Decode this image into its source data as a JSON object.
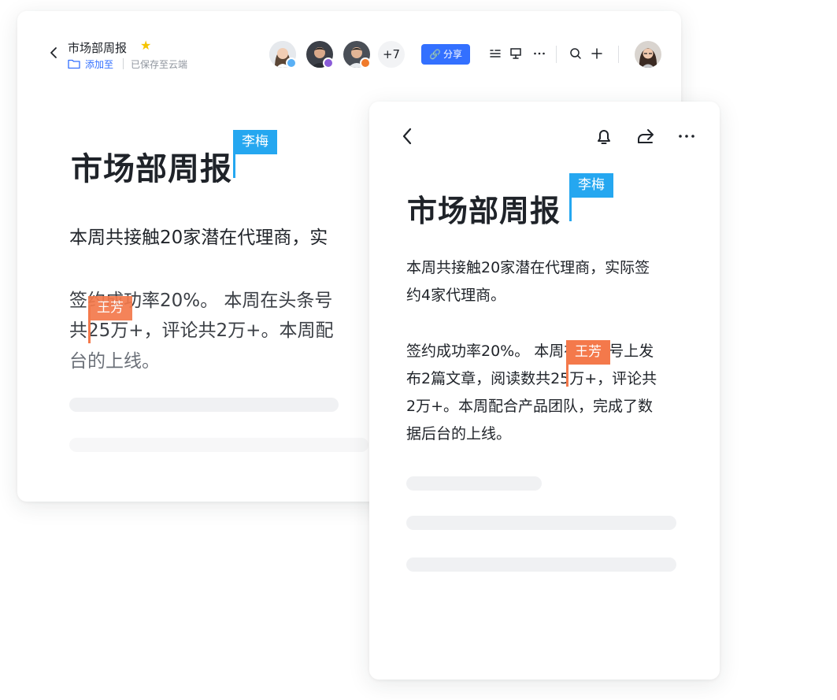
{
  "desktop": {
    "doc_title": "市场部周报",
    "add_to_label": "添加至",
    "save_status": "已保存至云端",
    "extra_collaborators": "+7",
    "share_label": "分享",
    "heading": "市场部周报",
    "cursor_user_top": "李梅",
    "cursor_user_body": "王芳",
    "lines": [
      "本周共接触20家潜在代理商，实",
      "签约成功率20%。 本周在头条号",
      "共25万+，评论共2万+。本周配",
      "台的上线。"
    ]
  },
  "mobile": {
    "heading": "市场部周报",
    "cursor_user_top": "李梅",
    "cursor_user_body": "王芳",
    "lines": [
      "本周共接触20家潜在代理商，实际签",
      "约4家代理商。",
      "签约成功率20%。 本周在头条号上发",
      "布2篇文章，阅读数共25万+，评论共",
      "2万+。本周配合产品团队，完成了数",
      "据后台的上线。"
    ]
  },
  "icons": {
    "back": "chevron-left-icon",
    "star": "star-icon",
    "folder": "folder-icon",
    "link": "link-icon",
    "outline": "outline-icon",
    "present": "presentation-icon",
    "more": "more-horizontal-icon",
    "search": "search-icon",
    "add": "plus-icon",
    "bell": "bell-icon",
    "forward": "forward-icon"
  },
  "colors": {
    "accent_blue": "#3370ff",
    "cursor_blue": "#25a7f0",
    "cursor_orange": "#f4794b",
    "star": "#f5c400"
  }
}
